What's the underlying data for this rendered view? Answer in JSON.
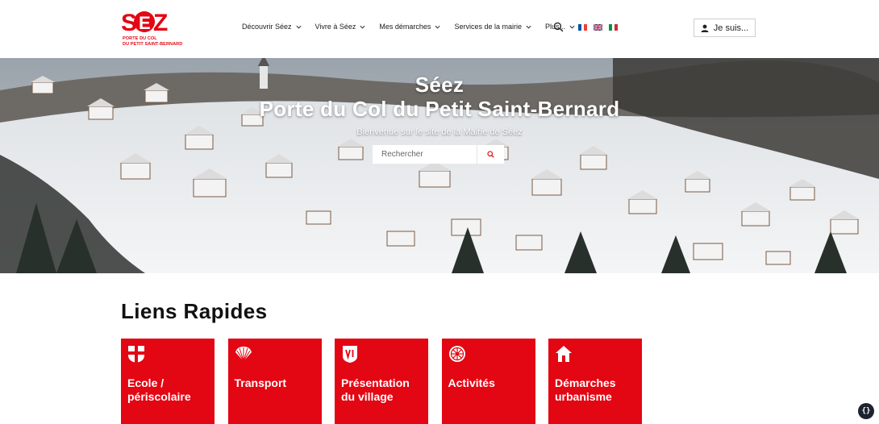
{
  "logo": {
    "wordmark": "SÉEZ",
    "line1": "PORTE DU COL",
    "line2": "DU PETIT SAINT-BERNARD"
  },
  "nav": {
    "items": [
      {
        "label": "Découvrir Séez",
        "has_dropdown": true
      },
      {
        "label": "Vivre à Séez",
        "has_dropdown": true
      },
      {
        "label": "Mes démarches",
        "has_dropdown": true
      },
      {
        "label": "Services de la mairie",
        "has_dropdown": true
      },
      {
        "label": "Plus...",
        "has_dropdown": true
      }
    ],
    "search_icon": "search-icon",
    "languages": [
      {
        "code": "fr",
        "colors": [
          "#0055a4",
          "#ffffff",
          "#ef4135"
        ]
      },
      {
        "code": "en",
        "colors": [
          "#012169",
          "#ffffff",
          "#c8102e"
        ]
      },
      {
        "code": "it",
        "colors": [
          "#009246",
          "#ffffff",
          "#ce2b37"
        ]
      }
    ],
    "iam_label": "Je suis..."
  },
  "hero": {
    "title_line1": "Séez",
    "title_line2": "Porte du Col du Petit Saint-Bernard",
    "subtitle": "Bienvenue sur le site de la Mairie de Séez",
    "search_placeholder": "Rechercher"
  },
  "quick_links": {
    "title": "Liens Rapides",
    "cards": [
      {
        "label": "Ecole / périscolaire",
        "icon": "savoie-cross-icon"
      },
      {
        "label": "Transport",
        "icon": "shell-icon"
      },
      {
        "label": "Présentation du village",
        "icon": "vi-badge-icon"
      },
      {
        "label": "Activités",
        "icon": "wheel-icon"
      },
      {
        "label": "Démarches urbanisme",
        "icon": "house-icon"
      }
    ]
  },
  "colors": {
    "brand_red": "#e30613",
    "text_dark": "#1b1b1b"
  },
  "floating_button": "{}"
}
